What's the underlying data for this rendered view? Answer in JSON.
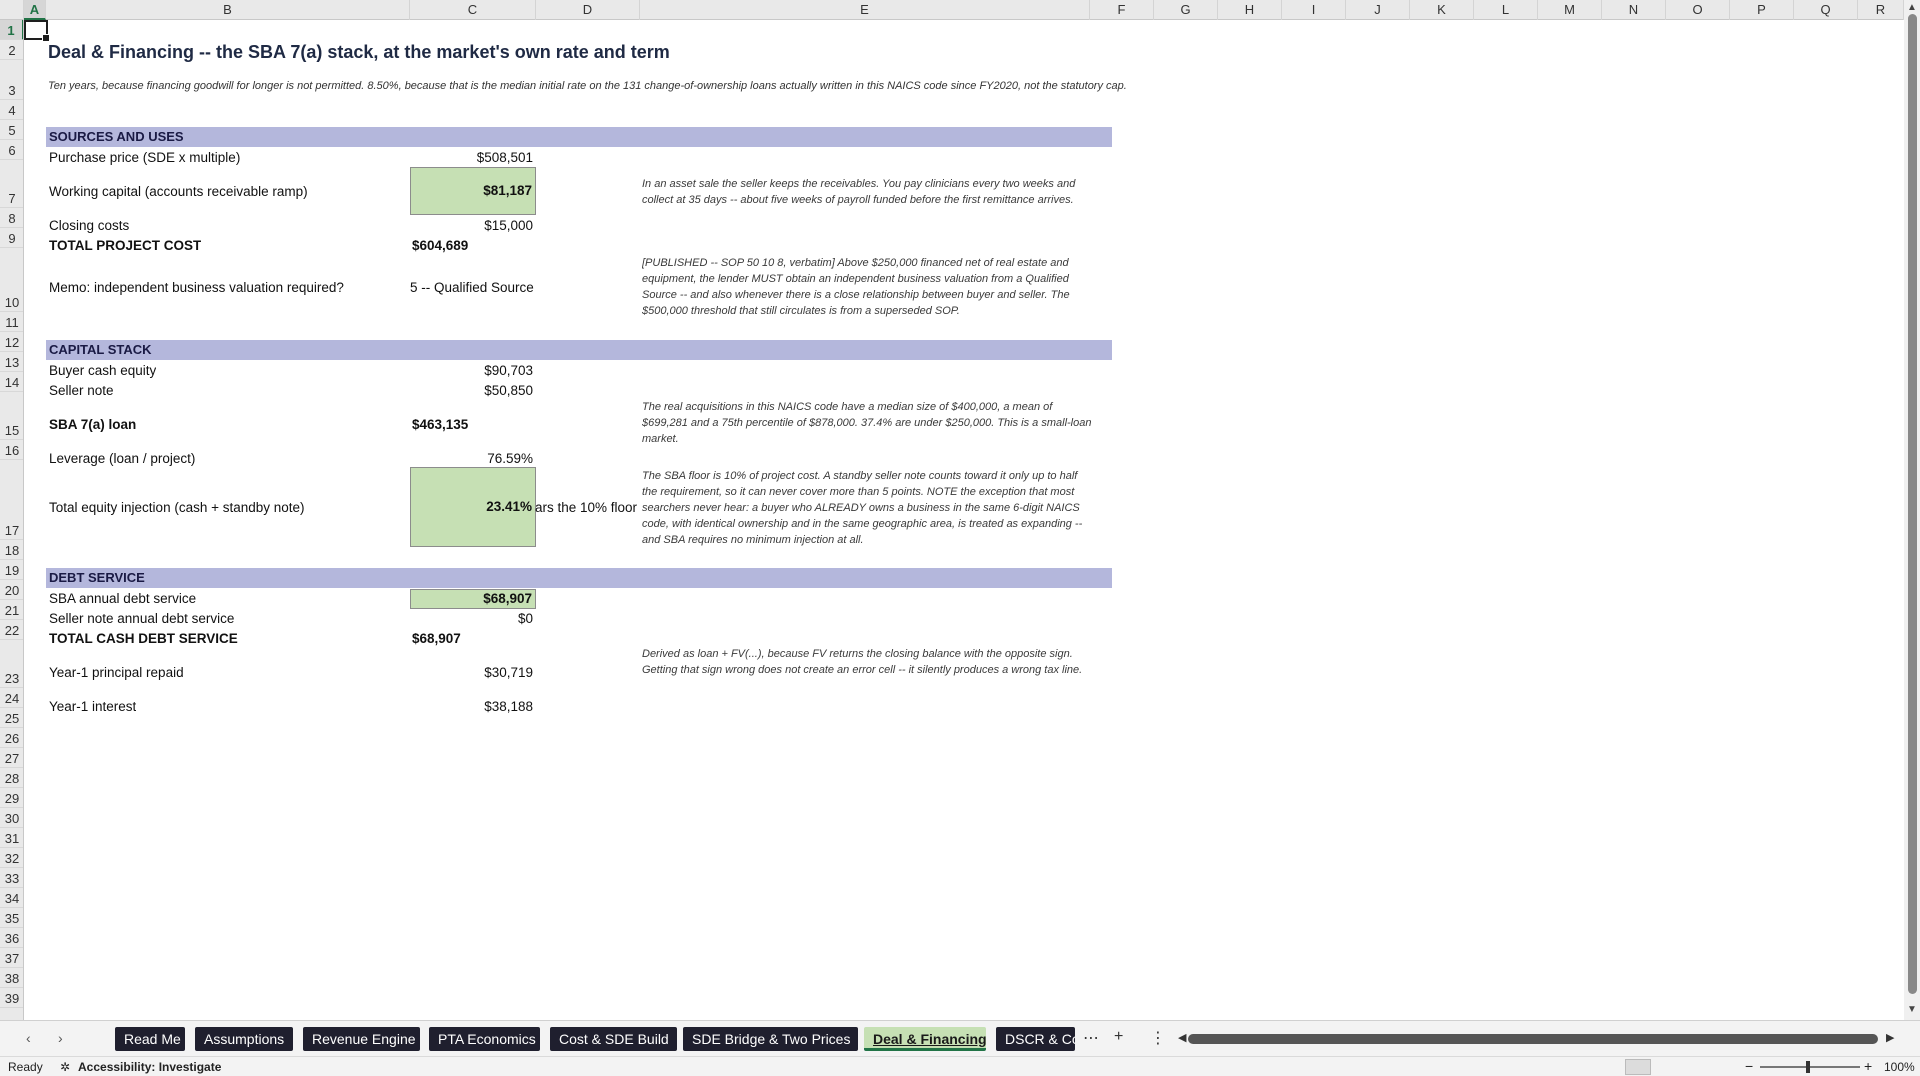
{
  "columns": [
    "A",
    "B",
    "C",
    "D",
    "E",
    "F",
    "G",
    "H",
    "I",
    "J",
    "K",
    "L",
    "M",
    "N",
    "O",
    "P",
    "Q",
    "R"
  ],
  "rows": [
    "1",
    "2",
    "3",
    "4",
    "5",
    "6",
    "7",
    "8",
    "9",
    "10",
    "11",
    "12",
    "13",
    "14",
    "15",
    "16",
    "17",
    "18",
    "19",
    "20",
    "21",
    "22",
    "23",
    "24",
    "25",
    "26",
    "27",
    "28",
    "29",
    "30",
    "31",
    "32",
    "33",
    "34",
    "35",
    "36",
    "37",
    "38",
    "39"
  ],
  "sheet": {
    "title": "Deal & Financing -- the SBA 7(a) stack, at the market's own rate and term",
    "subtitle": "Ten years, because financing goodwill for longer is not permitted. 8.50%, because that is the median initial rate on the 131 change-of-ownership loans actually written in this NAICS code since FY2020, not the statutory cap.",
    "sources_uses": {
      "header": "SOURCES AND USES",
      "purchase_label": "Purchase price (SDE x multiple)",
      "purchase_value": "$508,501",
      "wc_label": "Working capital (accounts receivable ramp)",
      "wc_value": "$81,187",
      "wc_note": "In an asset sale the seller keeps the receivables. You pay clinicians every two weeks and collect at 35 days -- about five weeks of payroll funded before the first remittance arrives.",
      "closing_label": "Closing costs",
      "closing_value": "$15,000",
      "total_label": "TOTAL PROJECT COST",
      "total_value": "$604,689",
      "memo_label": "Memo: independent business valuation required?",
      "memo_value": "5 -- Qualified Source",
      "memo_note": "[PUBLISHED -- SOP 50 10 8, verbatim] Above $250,000 financed net of real estate and equipment, the lender MUST obtain an independent business valuation from a Qualified Source -- and also whenever there is a close relationship between buyer and seller. The $500,000 threshold that still circulates is from a superseded SOP."
    },
    "capital_stack": {
      "header": "CAPITAL STACK",
      "buyer_label": "Buyer cash equity",
      "buyer_value": "$90,703",
      "seller_label": "Seller note",
      "seller_value": "$50,850",
      "sba_label": "SBA 7(a) loan",
      "sba_value": "$463,135",
      "sba_note": "The real acquisitions in this NAICS code have a median size of $400,000, a mean of $699,281 and a 75th percentile of $878,000. 37.4% are under $250,000. This is a small-loan market.",
      "leverage_label": "Leverage (loan / project)",
      "leverage_value": "76.59%",
      "equity_label": "Total equity injection (cash + standby note)",
      "equity_value": "23.41%",
      "equity_overflow": "ars the 10% floor",
      "equity_note": "The SBA floor is 10% of project cost. A standby seller note counts toward it only up to half the requirement, so it can never cover more than 5 points. NOTE the exception that most searchers never hear: a buyer who ALREADY owns a business in the same 6-digit NAICS code, with identical ownership and in the same geographic area, is treated as expanding -- and SBA requires no minimum injection at all."
    },
    "debt_service": {
      "header": "DEBT SERVICE",
      "sba_ds_label": "SBA annual debt service",
      "sba_ds_value": "$68,907",
      "seller_ds_label": "Seller note annual debt service",
      "seller_ds_value": "$0",
      "total_ds_label": "TOTAL CASH DEBT SERVICE",
      "total_ds_value": "$68,907",
      "principal_label": "Year-1 principal repaid",
      "principal_value": "$30,719",
      "principal_note": "Derived as loan + FV(...), because FV returns the closing balance with the opposite sign. Getting that sign wrong does not create an error cell -- it silently produces a wrong tax line.",
      "interest_label": "Year-1 interest",
      "interest_value": "$38,188"
    }
  },
  "tabs": [
    "Read Me",
    "Assumptions",
    "Revenue Engine",
    "PTA Economics",
    "Cost & SDE Build",
    "SDE Bridge & Two Prices",
    "Deal & Financing",
    "DSCR & Co"
  ],
  "status": {
    "ready": "Ready",
    "accessibility": "Accessibility: Investigate",
    "zoom": "100%"
  },
  "colors": {
    "section": "#b4b7dc",
    "input_green": "#c6e0b4",
    "accent": "#217346"
  }
}
